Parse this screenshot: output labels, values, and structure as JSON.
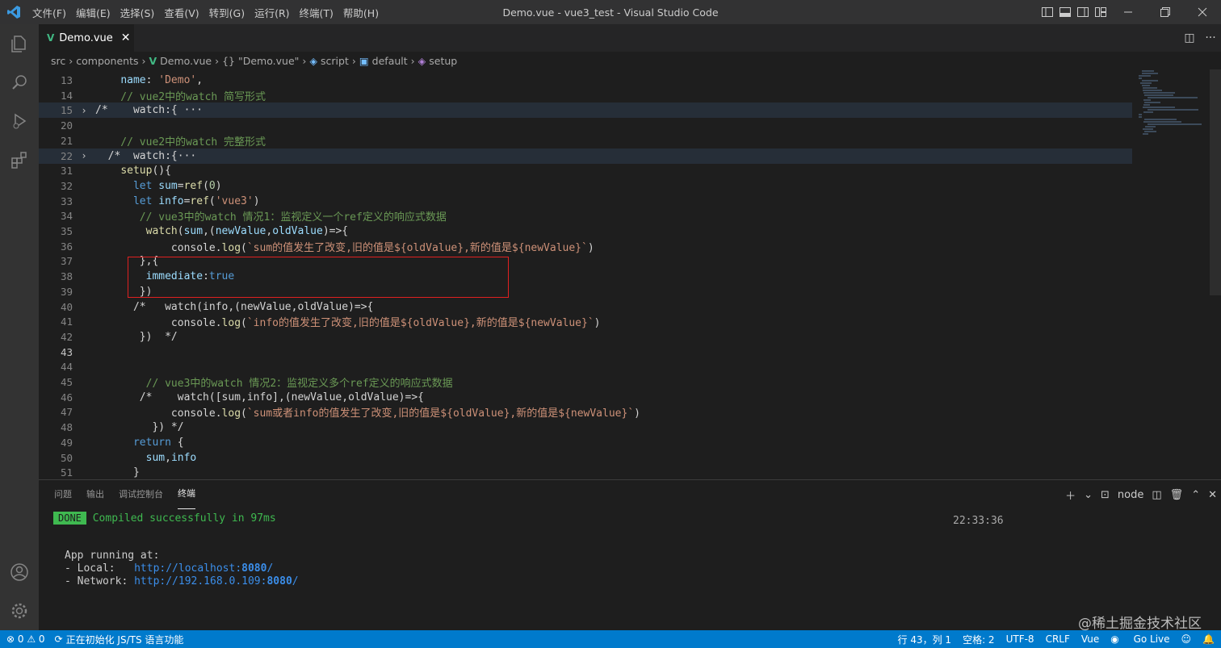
{
  "titlebar": {
    "menu": [
      "文件(F)",
      "编辑(E)",
      "选择(S)",
      "查看(V)",
      "转到(G)",
      "运行(R)",
      "终端(T)",
      "帮助(H)"
    ],
    "title": "Demo.vue - vue3_test - Visual Studio Code"
  },
  "tab": {
    "label": "Demo.vue",
    "close": "✕"
  },
  "breadcrumb": [
    "src",
    "components",
    "Demo.vue",
    "\"Demo.vue\"",
    "script",
    "default",
    "setup"
  ],
  "editor": {
    "lines": [
      {
        "n": "13",
        "code": "    name: 'Demo',"
      },
      {
        "n": "14",
        "code": "    // vue2中的watch 简写形式"
      },
      {
        "n": "15",
        "code": "/*    watch:{ ···"
      },
      {
        "n": "20",
        "code": ""
      },
      {
        "n": "21",
        "code": "    // vue2中的watch 完整形式"
      },
      {
        "n": "22",
        "code": "  /*  watch:{···"
      },
      {
        "n": "31",
        "code": "    setup(){"
      },
      {
        "n": "32",
        "code": "      let sum=ref(0)"
      },
      {
        "n": "33",
        "code": "      let info=ref('vue3')"
      },
      {
        "n": "34",
        "code": "       // vue3中的watch 情况1：监视定义一个ref定义的响应式数据"
      },
      {
        "n": "35",
        "code": "        watch(sum,(newValue,oldValue)=>{"
      },
      {
        "n": "36",
        "code": "            console.log(`sum的值发生了改变,旧的值是${oldValue},新的值是${newValue}`)"
      },
      {
        "n": "37",
        "code": "       },{"
      },
      {
        "n": "38",
        "code": "        immediate:true"
      },
      {
        "n": "39",
        "code": "       })"
      },
      {
        "n": "40",
        "code": "      /*   watch(info,(newValue,oldValue)=>{"
      },
      {
        "n": "41",
        "code": "            console.log(`info的值发生了改变,旧的值是${oldValue},新的值是${newValue}`)"
      },
      {
        "n": "42",
        "code": "       })  */"
      },
      {
        "n": "43",
        "code": ""
      },
      {
        "n": "44",
        "code": ""
      },
      {
        "n": "45",
        "code": "        // vue3中的watch 情况2：监视定义多个ref定义的响应式数据"
      },
      {
        "n": "46",
        "code": "       /*    watch([sum,info],(newValue,oldValue)=>{"
      },
      {
        "n": "47",
        "code": "            console.log(`sum或者info的值发生了改变,旧的值是${oldValue},新的值是${newValue}`)"
      },
      {
        "n": "48",
        "code": "         }) */"
      },
      {
        "n": "49",
        "code": "      return {"
      },
      {
        "n": "50",
        "code": "        sum,info"
      },
      {
        "n": "51",
        "code": "      }"
      }
    ]
  },
  "panel": {
    "tabs": [
      "问题",
      "输出",
      "调试控制台",
      "终端"
    ],
    "active_tab": "终端",
    "terminal_name": "node",
    "done_badge": "DONE",
    "compiled": "Compiled successfully in 97ms",
    "time": "22:33:36",
    "app_running": "App running at:",
    "local_label": "- Local:   ",
    "local_url_host": "http://localhost:",
    "local_url_port": "8080",
    "local_url_tail": "/",
    "network_label": "- Network: ",
    "network_url_host": "http://192.168.0.109:",
    "network_url_port": "8080",
    "network_url_tail": "/"
  },
  "statusbar": {
    "errors": "⊗ 0 ⚠ 0",
    "task": "正在初始化 JS/TS 语言功能",
    "position": "行 43，列 1",
    "spaces": "空格: 2",
    "encoding": "UTF-8",
    "eol": "CRLF",
    "language": "Vue",
    "golive": "Go Live"
  },
  "watermark": "@稀土掘金技术社区",
  "colors": {
    "accent": "#007acc",
    "vue": "#41b883",
    "highlight_box": "#e02020"
  }
}
